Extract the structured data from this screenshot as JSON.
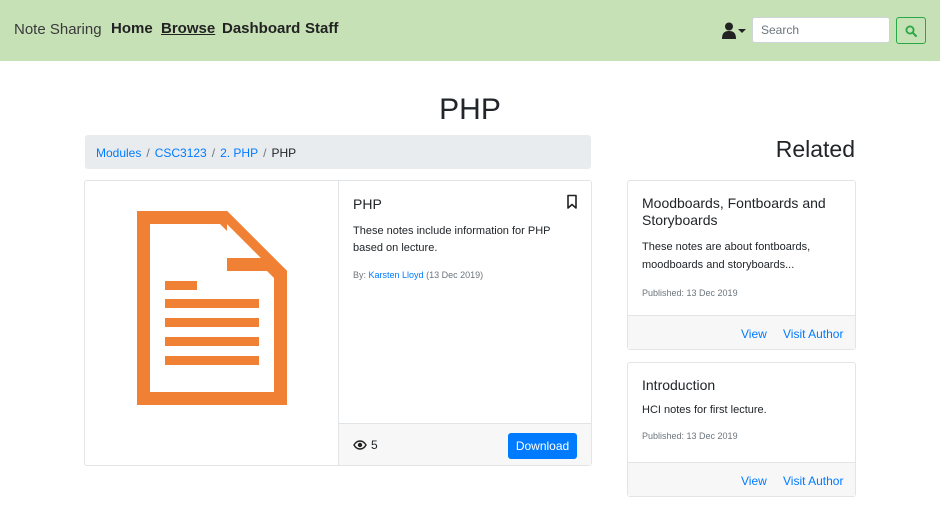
{
  "navbar": {
    "brand": "Note Sharing",
    "links": [
      {
        "label": "Home",
        "active": false
      },
      {
        "label": "Browse",
        "active": true
      },
      {
        "label": "Dashboard",
        "active": false
      },
      {
        "label": "Staff",
        "active": false
      }
    ],
    "search": {
      "placeholder": "Search",
      "value": ""
    },
    "icons": {
      "user": "user-icon",
      "dropdown": "caret-down-icon",
      "search": "search-icon"
    },
    "colors": {
      "background": "#c7e1b7",
      "search_button": "#28a745"
    }
  },
  "page": {
    "title": "PHP"
  },
  "breadcrumb": {
    "items": [
      "Modules",
      "CSC3123",
      "2. PHP"
    ],
    "current": "PHP"
  },
  "note": {
    "title": "PHP",
    "description": "These notes include information for PHP based on lecture.",
    "by_label": "By:",
    "author": "Karsten Lloyd",
    "date": "(13 Dec 2019)",
    "views": "5",
    "download_label": "Download",
    "icons": {
      "document": "document-icon",
      "bookmark": "bookmark-icon",
      "views": "eye-icon"
    },
    "colors": {
      "document": "#f08033",
      "download": "#007bff"
    }
  },
  "related": {
    "heading": "Related",
    "items": [
      {
        "title": "Moodboards, Fontboards and Storyboards",
        "description": "These notes are about fontboards, moodboards and storyboards...",
        "published": "Published: 13 Dec 2019",
        "view_label": "View",
        "author_label": "Visit Author"
      },
      {
        "title": "Introduction",
        "description": "HCI notes for first lecture.",
        "published": "Published: 13 Dec 2019",
        "view_label": "View",
        "author_label": "Visit Author"
      }
    ]
  }
}
